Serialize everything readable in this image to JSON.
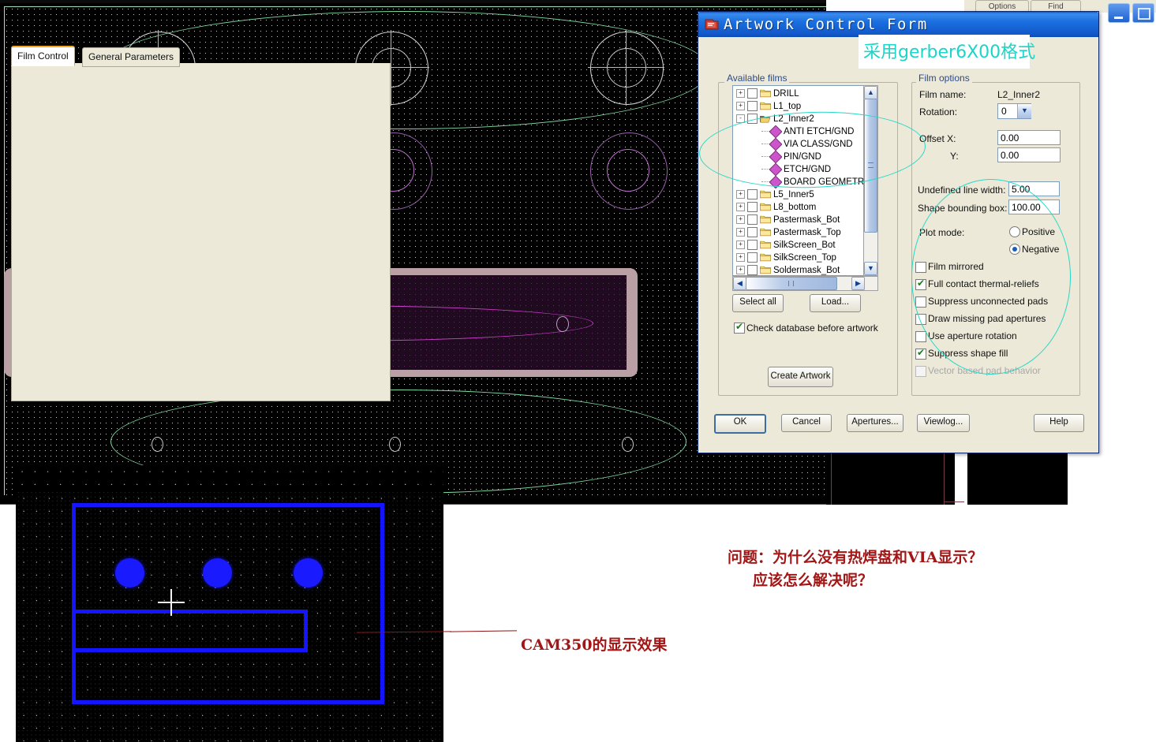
{
  "dialog": {
    "title": "Artwork Control Form",
    "icon": "artwork-form-icon",
    "titlebar_buttons": [
      {
        "name": "minimize-button",
        "glyph": "–"
      },
      {
        "name": "maximize-button",
        "glyph": "□"
      },
      {
        "name": "close-button",
        "glyph": "✕"
      }
    ],
    "tabs": [
      {
        "label": "Film Control",
        "selected": true
      },
      {
        "label": "General Parameters",
        "selected": false
      }
    ],
    "available_films": {
      "group_label": "Available films",
      "nodes": [
        {
          "label": "DRILL",
          "type": "folder",
          "expander": "+",
          "checked": false,
          "indent": 0
        },
        {
          "label": "L1_top",
          "type": "folder",
          "expander": "+",
          "checked": false,
          "indent": 0
        },
        {
          "label": "L2_Inner2",
          "type": "folder-open",
          "expander": "-",
          "checked": false,
          "indent": 0
        },
        {
          "label": "ANTI ETCH/GND",
          "type": "layer",
          "indent": 1
        },
        {
          "label": "VIA CLASS/GND",
          "type": "layer",
          "indent": 1
        },
        {
          "label": "PIN/GND",
          "type": "layer",
          "indent": 1
        },
        {
          "label": "ETCH/GND",
          "type": "layer",
          "indent": 1
        },
        {
          "label": "BOARD GEOMETRY/",
          "type": "layer",
          "indent": 1
        },
        {
          "label": "L5_Inner5",
          "type": "folder",
          "expander": "+",
          "checked": false,
          "indent": 0
        },
        {
          "label": "L8_bottom",
          "type": "folder",
          "expander": "+",
          "checked": false,
          "indent": 0
        },
        {
          "label": "Pastermask_Bot",
          "type": "folder",
          "expander": "+",
          "checked": false,
          "indent": 0
        },
        {
          "label": "Pastermask_Top",
          "type": "folder",
          "expander": "+",
          "checked": false,
          "indent": 0
        },
        {
          "label": "SilkScreen_Bot",
          "type": "folder",
          "expander": "+",
          "checked": false,
          "indent": 0
        },
        {
          "label": "SilkScreen_Top",
          "type": "folder",
          "expander": "+",
          "checked": false,
          "indent": 0
        },
        {
          "label": "Soldermask_Bot",
          "type": "folder",
          "expander": "+",
          "checked": false,
          "indent": 0
        }
      ]
    },
    "select_all_label": "Select all",
    "load_label": "Load...",
    "check_db_label": "Check database before artwork",
    "check_db_checked": true,
    "create_artwork_label": "Create Artwork",
    "film_options": {
      "group_label": "Film options",
      "film_name_label": "Film name:",
      "film_name_value": "L2_Inner2",
      "rotation_label": "Rotation:",
      "rotation_value": "0",
      "offset_label": "Offset  X:",
      "offset_y_label": "Y:",
      "offset_x_value": "0.00",
      "offset_y_value": "0.00",
      "undefined_line_width_label": "Undefined line width:",
      "undefined_line_width_value": "5.00",
      "shape_bounding_box_label": "Shape bounding box:",
      "shape_bounding_box_value": "100.00",
      "plot_mode_label": "Plot mode:",
      "plot_mode_positive": "Positive",
      "plot_mode_negative": "Negative",
      "plot_mode_selected": "Negative",
      "checkboxes": [
        {
          "label": "Film mirrored",
          "checked": false,
          "disabled": false
        },
        {
          "label": "Full contact thermal-reliefs",
          "checked": true,
          "disabled": false
        },
        {
          "label": "Suppress unconnected pads",
          "checked": false,
          "disabled": false
        },
        {
          "label": "Draw missing pad apertures",
          "checked": false,
          "disabled": false
        },
        {
          "label": "Use aperture rotation",
          "checked": false,
          "disabled": false
        },
        {
          "label": "Suppress shape fill",
          "checked": true,
          "disabled": false
        },
        {
          "label": "Vector based pad behavior",
          "checked": false,
          "disabled": true
        }
      ]
    },
    "footer_buttons": [
      {
        "label": "OK",
        "default": true
      },
      {
        "label": "Cancel",
        "default": false
      },
      {
        "label": "Apertures...",
        "default": false
      },
      {
        "label": "Viewlog...",
        "default": false
      },
      {
        "label": "Help",
        "default": false
      }
    ]
  },
  "background_window": {
    "tabs": [
      {
        "label": "Options"
      },
      {
        "label": "Find"
      }
    ]
  },
  "annotations": {
    "gerber_note": "采用gerber6X00格式",
    "gerber_note_color": "#19d6c8",
    "question_line1": "问题：为什么没有热焊盘和VIA显示？",
    "question_line2": "应该怎么解决呢？",
    "cam_label": "CAM350的显示效果",
    "red_color": "#a31616",
    "highlight_ellipse_color": "#27d8c8"
  },
  "pcb_view": {
    "name": "allegro-artwork-canvas",
    "background": "#000000",
    "grid_dot_color": "#cfcfcf",
    "board_outline_color": "#7fdca2",
    "shape_color": "#baa0a5",
    "anti_etch_color": "#d13fd1"
  },
  "cam_view": {
    "name": "cam350-canvas",
    "background": "#000000",
    "trace_color": "#1414ff",
    "pad_color": "#1a1aff",
    "cursor_color": "#f2f2f2",
    "pad_count": 3
  }
}
